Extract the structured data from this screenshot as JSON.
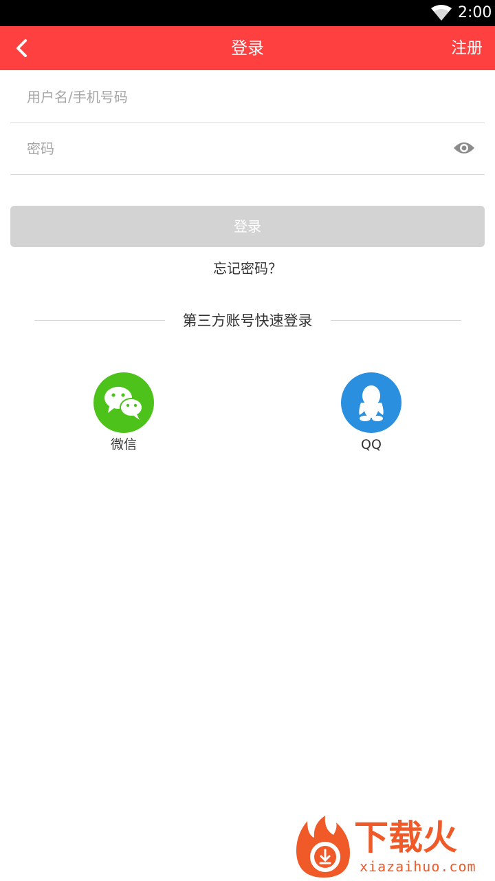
{
  "status_bar": {
    "time": "2:00"
  },
  "app_bar": {
    "title": "登录",
    "register_label": "注册"
  },
  "form": {
    "username_placeholder": "用户名/手机号码",
    "password_placeholder": "密码",
    "login_label": "登录",
    "forgot_label": "忘记密码？"
  },
  "third_party": {
    "title": "第三方账号快速登录",
    "wechat_label": "微信",
    "qq_label": "QQ"
  },
  "watermark": {
    "brand": "下载火",
    "url": "xiazaihuo.com"
  },
  "colors": {
    "header": "#ff4040",
    "wechat": "#4cc21a",
    "qq": "#2b8fe0",
    "login_disabled": "#d3d3d3",
    "watermark": "#f05a28"
  }
}
